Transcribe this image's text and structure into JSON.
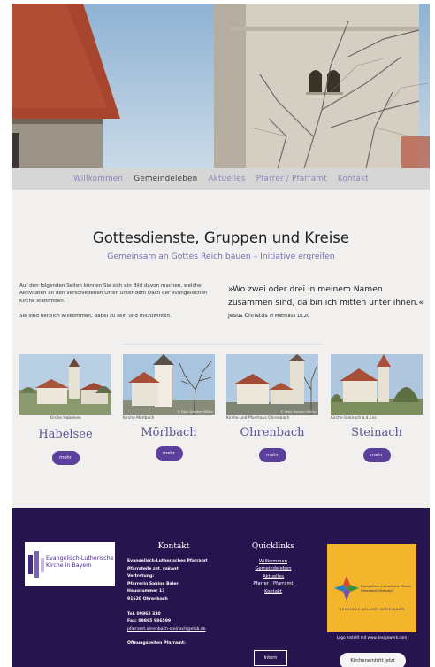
{
  "nav": {
    "items": [
      "Willkommen",
      "Gemeindeleben",
      "Aktuelles",
      "Pfarrer / Pfarramt",
      "Kontakt"
    ],
    "active": "Gemeindeleben"
  },
  "main": {
    "title": "Gottesdienste, Gruppen und Kreise",
    "subtitle": "Gemeinsam an Gottes Reich bauen – Initiative ergreifen",
    "intro_1": "Auf den folgenden Seiten können Sie sich ein Bild davon machen, welche Aktivitäten an den verschiedenen Orten unter dem Dach der evangelischen Kirche stattfinden.",
    "intro_2": "Sie sind herzlich willkommen, dabei zu sein und mitzuwirken.",
    "quote": "»Wo zwei oder drei in meinem Namen zusammen sind, da bin ich mitten unter ihnen.«",
    "quote_author": "Jesus Christus",
    "quote_ref": "in Matthäus 18,20"
  },
  "places": [
    {
      "caption": "Kirche Habelsee",
      "name": "Habelsee",
      "button": "mehr",
      "credit": ""
    },
    {
      "caption": "Kirche Mörlbach",
      "name": "Mörlbach",
      "button": "mehr",
      "credit": "© Foto: Karsten Müller"
    },
    {
      "caption": "Kirche und Pfarrhaus Ohrenbach",
      "name": "Ohrenbach",
      "button": "mehr",
      "credit": "© Foto: Karsten Müller"
    },
    {
      "caption": "Kirche Steinach a.d.Ens",
      "name": "Steinach",
      "button": "mehr",
      "credit": ""
    }
  ],
  "footer": {
    "elkb_logo_text_1": "Evangelisch-Lutherische",
    "elkb_logo_text_2": "Kirche in Bayern",
    "contact_title": "Kontakt",
    "contact": {
      "l1": "Evangelisch-Lutherisches Pfarramt",
      "l2": "Pfarrstelle zzt. vakant",
      "l3": "Vertretung:",
      "l4": "Pfarrerin Sabine Baier",
      "l5": "Hausnummer 13",
      "l6": "91620 Ohrenbach",
      "tel": "Tel. 09865 330",
      "fax": "Fax: 09865 986599",
      "mail": "pfarramt.ohrenbach-steinach@elkb.de",
      "hours": "Öffnungszeiten Pfarramt:"
    },
    "quicklinks_title": "Quicklinks",
    "quicklinks": [
      "Willkommen",
      "Gemeindeleben",
      "Aktuelles",
      "Pfarrer / Pfarramt",
      "Kontakt"
    ],
    "logo2_line1": "Evangelisch-Lutherische Pfarrei",
    "logo2_line2": "Ohrenbach-Steinach",
    "logo2_tagline": "GEMEINDE BELIEBT GEMEINSAM",
    "logo_credit": "Logo erstellt mit www.designwerk.com",
    "intern": "Intern",
    "kirchen_button": "Kircheneintritt jetzt"
  },
  "colors": {
    "accent": "#5b3f9c",
    "footer_bg": "#26144f",
    "nav_bg": "#d6d6d6",
    "nav_link": "#8e85b5",
    "logo2_bg": "#f2b52c"
  }
}
